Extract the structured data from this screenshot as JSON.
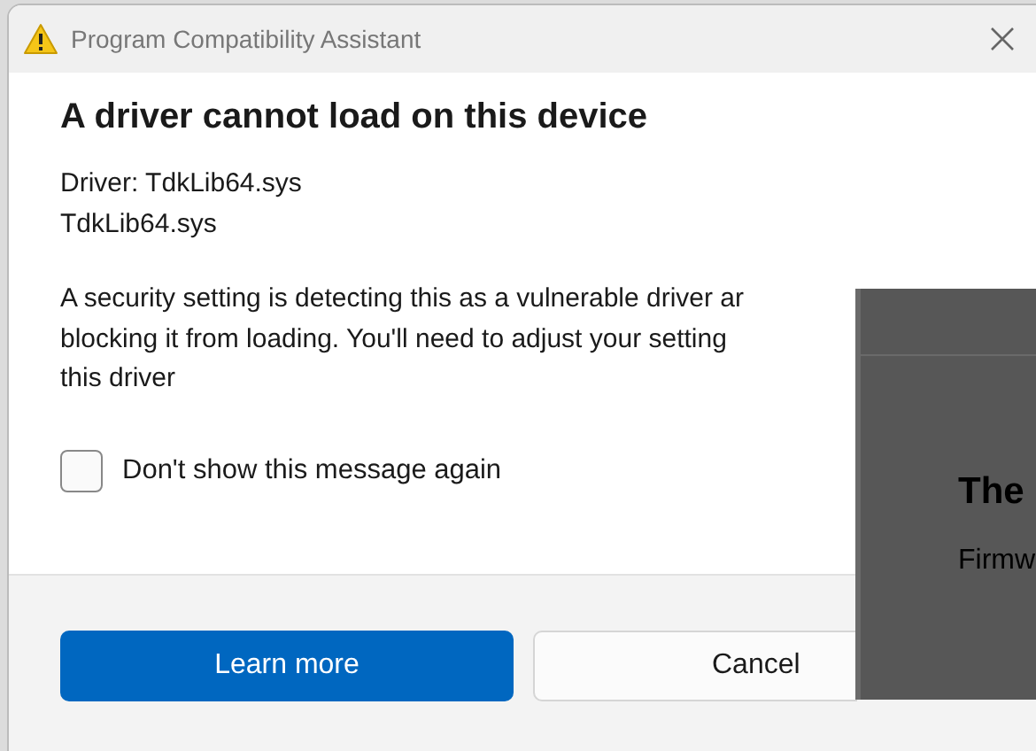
{
  "window": {
    "title": "Program Compatibility Assistant"
  },
  "heading": "A driver cannot load on this device",
  "driver_lines": [
    "Driver: TdkLib64.sys",
    "TdkLib64.sys"
  ],
  "message_lines": [
    "A security setting is detecting this as a vulnerable driver ar",
    "blocking it from loading. You'll need to adjust your setting",
    "this driver"
  ],
  "checkbox": {
    "label": "Don't show this message again",
    "checked": false
  },
  "buttons": [
    {
      "label": "Learn more",
      "kind": "primary"
    },
    {
      "label": "Cancel",
      "kind": "secondary"
    }
  ],
  "background_window": {
    "heading": "The",
    "text": "Firmw"
  }
}
